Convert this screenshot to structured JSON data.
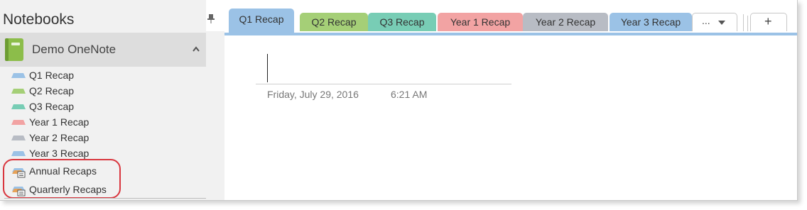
{
  "sidebar": {
    "title": "Notebooks",
    "notebook": {
      "label": "Demo OneNote",
      "icon": "notebook-icon",
      "color": "#8cbd4a"
    },
    "sections": [
      {
        "label": "Q1 Recap",
        "color": "#9bc2e6"
      },
      {
        "label": "Q2 Recap",
        "color": "#a5cf77"
      },
      {
        "label": "Q3 Recap",
        "color": "#78cdb5"
      },
      {
        "label": "Year 1 Recap",
        "color": "#f2a3a3"
      },
      {
        "label": "Year 2 Recap",
        "color": "#b8bcc4"
      },
      {
        "label": "Year 3 Recap",
        "color": "#9bc2e6"
      }
    ],
    "groups": [
      {
        "label": "Annual Recaps",
        "icon": "section-group-icon"
      },
      {
        "label": "Quarterly Recaps",
        "icon": "section-group-icon"
      }
    ],
    "highlight_color": "#d9363e"
  },
  "tabs": [
    {
      "label": "Q1 Recap",
      "color": "#9bc2e6",
      "active": true
    },
    {
      "label": "Q2 Recap",
      "color": "#a5cf77"
    },
    {
      "label": "Q3 Recap",
      "color": "#78cdb5"
    },
    {
      "label": "Year 1 Recap",
      "color": "#f2a3a3"
    },
    {
      "label": "Year 2 Recap",
      "color": "#b8bcc4"
    },
    {
      "label": "Year 3 Recap",
      "color": "#9bc2e6"
    }
  ],
  "tab_more": {
    "label": "...",
    "icon": "chevron-down-icon"
  },
  "tab_add": {
    "label": "+"
  },
  "page": {
    "date": "Friday, July 29, 2016",
    "time": "6:21 AM"
  }
}
